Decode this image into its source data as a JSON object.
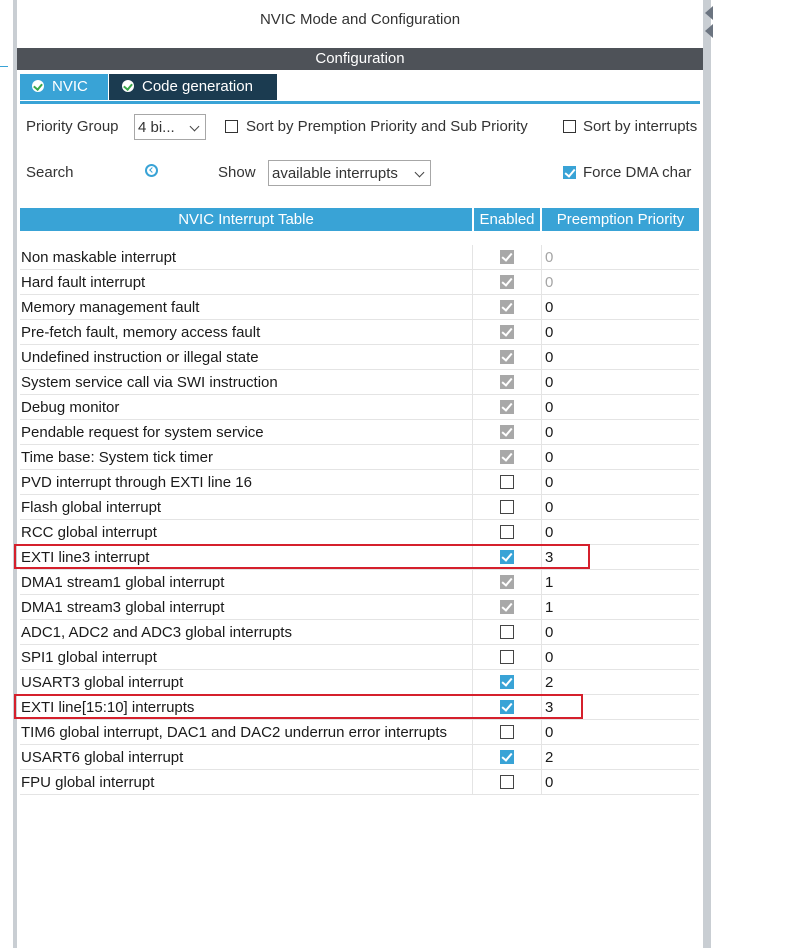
{
  "window_title": "NVIC Mode and Configuration",
  "config_header": "Configuration",
  "tabs": [
    {
      "label": "NVIC",
      "active": true
    },
    {
      "label": "Code generation",
      "active": false
    }
  ],
  "options": {
    "priority_group_label": "Priority Group",
    "priority_group_value": "4 bi...",
    "sort_premption_label": "Sort by Premption Priority and Sub Priority",
    "sort_premption_checked": false,
    "sort_interrupts_label": "Sort by interrupts",
    "sort_interrupts_checked": false,
    "search_label": "Search",
    "show_label": "Show",
    "show_value": "available interrupts",
    "force_dma_label": "Force DMA char",
    "force_dma_checked": true
  },
  "table": {
    "headers": [
      "NVIC Interrupt Table",
      "Enabled",
      "Preemption Priority"
    ],
    "rows": [
      {
        "name": "Non maskable interrupt",
        "enabled": "grey",
        "priority": "0",
        "dim": true
      },
      {
        "name": "Hard fault interrupt",
        "enabled": "grey",
        "priority": "0",
        "dim": true
      },
      {
        "name": "Memory management fault",
        "enabled": "grey",
        "priority": "0"
      },
      {
        "name": "Pre-fetch fault, memory access fault",
        "enabled": "grey",
        "priority": "0"
      },
      {
        "name": "Undefined instruction or illegal state",
        "enabled": "grey",
        "priority": "0"
      },
      {
        "name": "System service call via SWI instruction",
        "enabled": "grey",
        "priority": "0"
      },
      {
        "name": "Debug monitor",
        "enabled": "grey",
        "priority": "0"
      },
      {
        "name": "Pendable request for system service",
        "enabled": "grey",
        "priority": "0"
      },
      {
        "name": "Time base: System tick timer",
        "enabled": "grey",
        "priority": "0"
      },
      {
        "name": "PVD interrupt through EXTI line 16",
        "enabled": "off",
        "priority": "0"
      },
      {
        "name": "Flash global interrupt",
        "enabled": "off",
        "priority": "0"
      },
      {
        "name": "RCC global interrupt",
        "enabled": "off",
        "priority": "0"
      },
      {
        "name": "EXTI line3 interrupt",
        "enabled": "blue",
        "priority": "3",
        "highlight": true
      },
      {
        "name": "DMA1 stream1 global interrupt",
        "enabled": "grey",
        "priority": "1"
      },
      {
        "name": "DMA1 stream3 global interrupt",
        "enabled": "grey",
        "priority": "1"
      },
      {
        "name": "ADC1, ADC2 and ADC3 global interrupts",
        "enabled": "off",
        "priority": "0"
      },
      {
        "name": "SPI1 global interrupt",
        "enabled": "off",
        "priority": "0"
      },
      {
        "name": "USART3 global interrupt",
        "enabled": "blue",
        "priority": "2"
      },
      {
        "name": "EXTI line[15:10] interrupts",
        "enabled": "blue",
        "priority": "3",
        "highlight": true
      },
      {
        "name": "TIM6 global interrupt, DAC1 and DAC2 underrun error interrupts",
        "enabled": "off",
        "priority": "0"
      },
      {
        "name": "USART6 global interrupt",
        "enabled": "blue",
        "priority": "2"
      },
      {
        "name": "FPU global interrupt",
        "enabled": "off",
        "priority": "0"
      }
    ]
  },
  "colors": {
    "accent": "#39a3d6",
    "tab_dark": "#1b3b50",
    "header_bar": "#4e5258",
    "highlight": "#d5202c"
  }
}
